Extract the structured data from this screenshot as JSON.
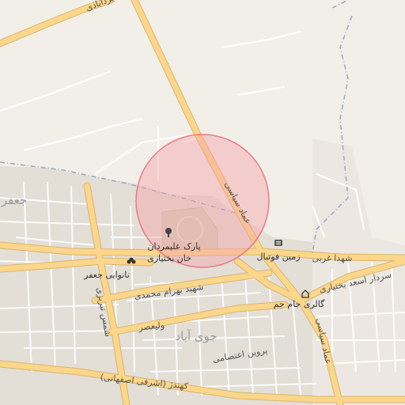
{
  "map": {
    "labels": {
      "top_left_road": "یزدآبادی",
      "area_left": "جعفر",
      "emad_siasi_north": "عماد سیاسی",
      "park_line1": "پارک علیمردان",
      "park_line2": "خان بختیاری",
      "football_field": "زمین فوتبال",
      "shohada_gharbi": "شهدا غربی",
      "asad_bakhtiari": "سردار اسعد بختیاری",
      "bakery": "نانوایی جعفر",
      "bahram_mohammadi": "شهید بهرام محمدی",
      "gallery": "گالری جام جم",
      "tabrizi": "شمس تبریزی",
      "valiasr": "ولیعصر",
      "joy_abad": "جوی آباد",
      "emad_siasi_south": "عماد سیاسی",
      "parvin": "پروین اعتصامی",
      "kohandez": "کهندژ (اشرفی اصفهانی)"
    },
    "colors": {
      "background": "#f2efe9",
      "built_area": "#e0dcd4",
      "road_major": "#fcd68a",
      "road_minor": "#ffffff",
      "park": "#d4d1ba",
      "highlight_fill": "#f4a3a8",
      "highlight_stroke": "#e8646f",
      "boundary": "#9aa6c9"
    },
    "icons": [
      "tree-icon",
      "bakery-icon",
      "stadium-icon",
      "gallery-icon"
    ]
  }
}
